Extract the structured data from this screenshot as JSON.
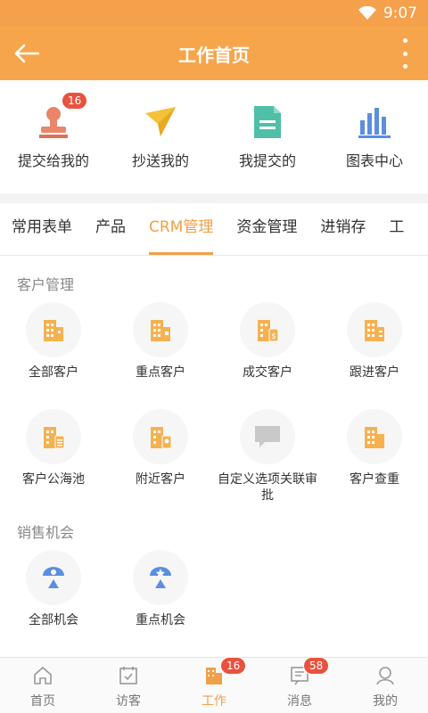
{
  "status": {
    "time": "9:07"
  },
  "appbar": {
    "title": "工作首页"
  },
  "quick": [
    {
      "label": "提交给我的",
      "badge": "16",
      "icon": "stamp-icon"
    },
    {
      "label": "抄送我的",
      "icon": "paper-plane-icon"
    },
    {
      "label": "我提交的",
      "icon": "document-icon"
    },
    {
      "label": "图表中心",
      "icon": "bar-chart-icon"
    }
  ],
  "tabs": [
    "常用表单",
    "产品",
    "CRM管理",
    "资金管理",
    "进销存",
    "工"
  ],
  "active_tab": "CRM管理",
  "sections": [
    {
      "title": "客户管理",
      "items": [
        "全部客户",
        "重点客户",
        "成交客户",
        "跟进客户",
        "客户公海池",
        "附近客户",
        "自定义选项关联审批",
        "客户查重"
      ]
    },
    {
      "title": "销售机会",
      "items": [
        "全部机会",
        "重点机会"
      ]
    }
  ],
  "nav": [
    {
      "label": "首页",
      "icon": "home-icon"
    },
    {
      "label": "访客",
      "icon": "calendar-check-icon"
    },
    {
      "label": "工作",
      "icon": "work-building-icon",
      "badge": "16"
    },
    {
      "label": "消息",
      "icon": "message-icon",
      "badge": "58"
    },
    {
      "label": "我的",
      "icon": "user-icon"
    }
  ],
  "colors": {
    "primary": "#f7a54b",
    "accent": "#f0a048",
    "badge": "#e8523f",
    "blue": "#5b8ee0",
    "teal": "#4fbfa8"
  }
}
